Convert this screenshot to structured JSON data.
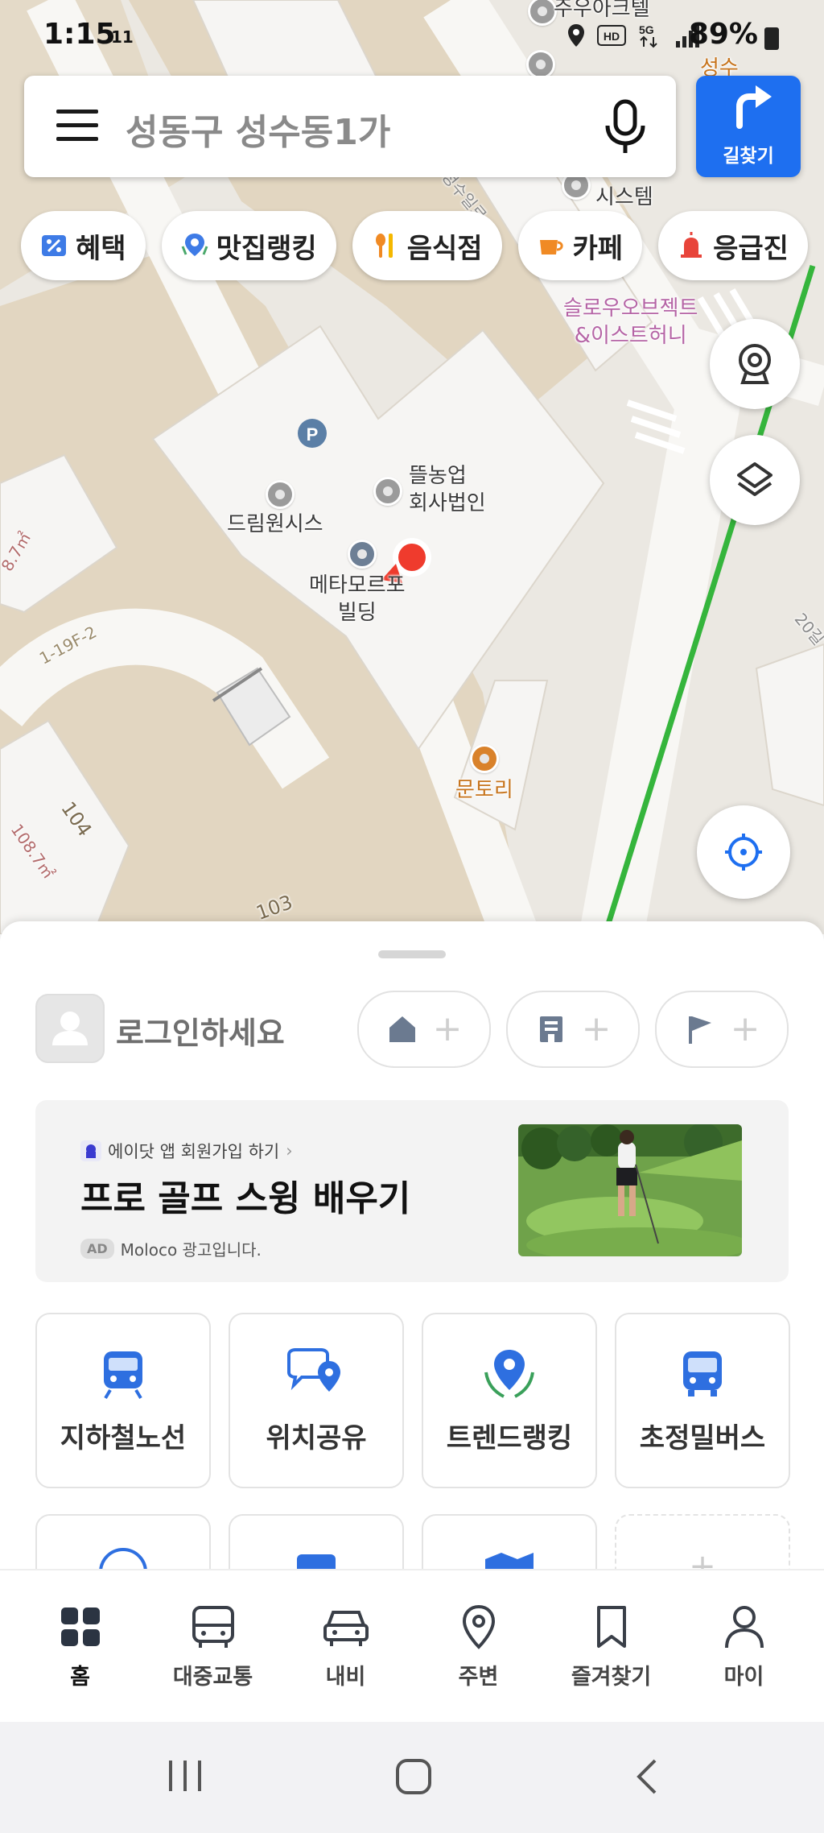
{
  "status_bar": {
    "time": "1:15",
    "extra": "11",
    "battery": "89%"
  },
  "search": {
    "placeholder": "성동구 성수동1가"
  },
  "route_button": {
    "label": "길찾기"
  },
  "chips": [
    {
      "label": "혜택",
      "icon": "discount-icon"
    },
    {
      "label": "맛집랭킹",
      "icon": "ranking-pin-icon"
    },
    {
      "label": "음식점",
      "icon": "utensils-icon"
    },
    {
      "label": "카페",
      "icon": "cup-icon"
    },
    {
      "label": "응급진",
      "icon": "siren-icon"
    }
  ],
  "map": {
    "labels": {
      "poi_top1": "주우아크텔",
      "poi_top2": "시스템",
      "poi_top_orange": "성수",
      "slow": "슬로우오브젝트\n&이스트허니",
      "ttum": "뜰농업\n회사법인",
      "dream": "드림원시스",
      "meta": "메타모르포\n빌딩",
      "munto": "문토리",
      "area1": "8.7㎡",
      "area2": "108.7㎡",
      "lot1": "1-19F-2",
      "lot2": "104",
      "lot3": "103",
      "road1": "성수일로",
      "road2": "20길"
    }
  },
  "login": {
    "label": "로그인하세요"
  },
  "shortcuts": [
    {
      "icon": "home-icon"
    },
    {
      "icon": "building-icon"
    },
    {
      "icon": "flag-icon"
    }
  ],
  "ad": {
    "top_text": "에이닷 앱 회원가입 하기",
    "title": "프로 골프 스윙 배우기",
    "badge": "AD",
    "sub": "Moloco 광고입니다."
  },
  "tiles": [
    {
      "label": "지하철노선",
      "icon": "subway-icon"
    },
    {
      "label": "위치공유",
      "icon": "location-share-icon"
    },
    {
      "label": "트렌드랭킹",
      "icon": "trend-ranking-icon"
    },
    {
      "label": "초정밀버스",
      "icon": "bus-icon"
    }
  ],
  "bottom_nav": [
    {
      "label": "홈",
      "icon": "grid-icon"
    },
    {
      "label": "대중교통",
      "icon": "bus-icon"
    },
    {
      "label": "내비",
      "icon": "car-icon"
    },
    {
      "label": "주변",
      "icon": "pin-icon"
    },
    {
      "label": "즐겨찾기",
      "icon": "bookmark-icon"
    },
    {
      "label": "마이",
      "icon": "person-icon"
    }
  ],
  "colors": {
    "accent": "#1e6ff0",
    "route_line": "#35b53c",
    "map_block": "#e2d8c4",
    "map_building": "#f6f5f3",
    "location_dot": "#ef3b2d"
  }
}
